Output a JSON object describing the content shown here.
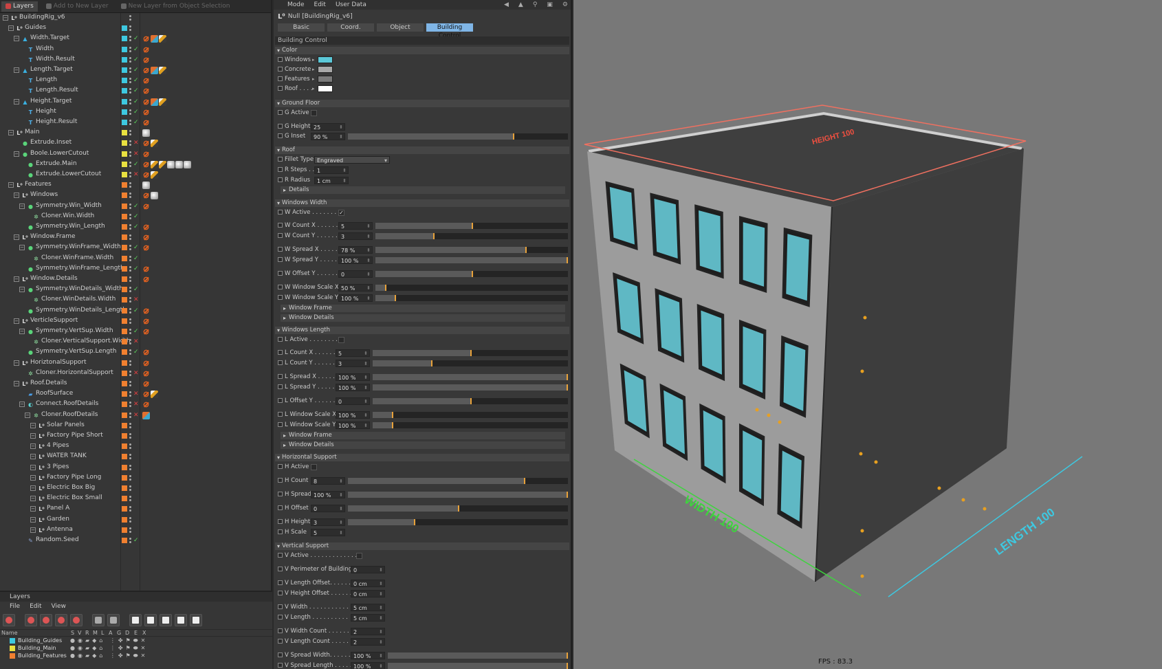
{
  "object_manager": {
    "tabs": [
      "Layers",
      "Add to New Layer",
      "New Layer from Object Selection"
    ],
    "tree": [
      {
        "label": "BuildingRig_v6",
        "indent": 0,
        "icon": "null",
        "layer": "",
        "tags": []
      },
      {
        "label": "Guides",
        "indent": 1,
        "icon": "null",
        "layer": "#3ec8e0",
        "tags": []
      },
      {
        "label": "Width.Target",
        "indent": 2,
        "icon": "triangle",
        "layer": "#3ec8e0",
        "tags": [
          "no",
          "mx",
          "fl"
        ]
      },
      {
        "label": "Width",
        "indent": 3,
        "icon": "text",
        "layer": "#3ec8e0",
        "tags": [
          "no"
        ]
      },
      {
        "label": "Width.Result",
        "indent": 3,
        "icon": "text",
        "layer": "#3ec8e0",
        "tags": [
          "no"
        ]
      },
      {
        "label": "Length.Target",
        "indent": 2,
        "icon": "triangle",
        "layer": "#3ec8e0",
        "tags": [
          "no",
          "mx",
          "fl"
        ]
      },
      {
        "label": "Length",
        "indent": 3,
        "icon": "text",
        "layer": "#3ec8e0",
        "tags": [
          "no"
        ]
      },
      {
        "label": "Length.Result",
        "indent": 3,
        "icon": "text",
        "layer": "#3ec8e0",
        "tags": [
          "no"
        ]
      },
      {
        "label": "Height.Target",
        "indent": 2,
        "icon": "triangle",
        "layer": "#3ec8e0",
        "tags": [
          "no",
          "mx",
          "fl"
        ]
      },
      {
        "label": "Height",
        "indent": 3,
        "icon": "text",
        "layer": "#3ec8e0",
        "tags": [
          "no"
        ]
      },
      {
        "label": "Height.Result",
        "indent": 3,
        "icon": "text",
        "layer": "#3ec8e0",
        "tags": [
          "no"
        ]
      },
      {
        "label": "Main",
        "indent": 1,
        "icon": "null",
        "layer": "#e8e040",
        "tags": [
          "sp"
        ]
      },
      {
        "label": "Extrude.Inset",
        "indent": 2,
        "icon": "green",
        "layer": "#e8e040",
        "tags": [
          "no",
          "fl"
        ]
      },
      {
        "label": "Boole.LowerCutout",
        "indent": 2,
        "icon": "green",
        "layer": "#e8e040",
        "tags": [
          "no"
        ]
      },
      {
        "label": "Extrude.Main",
        "indent": 3,
        "icon": "green",
        "layer": "#e8e040",
        "tags": [
          "no",
          "fl",
          "fl",
          "sp",
          "sp",
          "sp"
        ]
      },
      {
        "label": "Extrude.LowerCutout",
        "indent": 3,
        "icon": "green",
        "layer": "#e8e040",
        "tags": [
          "no",
          "fl"
        ]
      },
      {
        "label": "Features",
        "indent": 1,
        "icon": "null",
        "layer": "#f08030",
        "tags": [
          "sp"
        ]
      },
      {
        "label": "Windows",
        "indent": 2,
        "icon": "null",
        "layer": "#f08030",
        "tags": [
          "no",
          "sp"
        ]
      },
      {
        "label": "Symmetry.Win_Width",
        "indent": 3,
        "icon": "green",
        "layer": "#f08030",
        "tags": [
          "no"
        ]
      },
      {
        "label": "Cloner.Win.Width",
        "indent": 4,
        "icon": "gear",
        "layer": "#f08030",
        "tags": []
      },
      {
        "label": "Symmetry.Win_Length",
        "indent": 3,
        "icon": "green",
        "layer": "#f08030",
        "tags": [
          "no"
        ]
      },
      {
        "label": "Window.Frame",
        "indent": 2,
        "icon": "null",
        "layer": "#f08030",
        "tags": [
          "no"
        ]
      },
      {
        "label": "Symmetry.WinFrame_Width",
        "indent": 3,
        "icon": "green",
        "layer": "#f08030",
        "tags": [
          "no"
        ]
      },
      {
        "label": "Cloner.WinFrame.Width",
        "indent": 4,
        "icon": "gear",
        "layer": "#f08030",
        "tags": []
      },
      {
        "label": "Symmetry.WinFrame_Length",
        "indent": 3,
        "icon": "green",
        "layer": "#f08030",
        "tags": [
          "no"
        ]
      },
      {
        "label": "Window.Details",
        "indent": 2,
        "icon": "null",
        "layer": "#f08030",
        "tags": [
          "no"
        ]
      },
      {
        "label": "Symmetry.WinDetails_Width",
        "indent": 3,
        "icon": "green",
        "layer": "#f08030",
        "tags": []
      },
      {
        "label": "Cloner.WinDetails.Width",
        "indent": 4,
        "icon": "gear",
        "layer": "#f08030",
        "tags": []
      },
      {
        "label": "Symmetry.WinDetails_Length",
        "indent": 3,
        "icon": "green",
        "layer": "#f08030",
        "tags": [
          "no"
        ]
      },
      {
        "label": "VerticleSupport",
        "indent": 2,
        "icon": "null",
        "layer": "#f08030",
        "tags": [
          "no"
        ]
      },
      {
        "label": "Symmetry.VertSup.Width",
        "indent": 3,
        "icon": "green",
        "layer": "#f08030",
        "tags": [
          "no"
        ]
      },
      {
        "label": "Cloner.VerticalSupport.Width",
        "indent": 4,
        "icon": "gear",
        "layer": "#f08030",
        "tags": []
      },
      {
        "label": "Symmetry.VertSup.Length",
        "indent": 3,
        "icon": "green",
        "layer": "#f08030",
        "tags": [
          "no"
        ]
      },
      {
        "label": "HoriztonalSupport",
        "indent": 2,
        "icon": "null",
        "layer": "#f08030",
        "tags": [
          "no"
        ]
      },
      {
        "label": "Cloner.HorizontalSupport",
        "indent": 3,
        "icon": "gear",
        "layer": "#f08030",
        "tags": [
          "no"
        ]
      },
      {
        "label": "Roof.Details",
        "indent": 2,
        "icon": "null",
        "layer": "#f08030",
        "tags": [
          "no"
        ]
      },
      {
        "label": "RoofSurface",
        "indent": 3,
        "icon": "plane",
        "layer": "#f08030",
        "tags": [
          "no",
          "fl"
        ]
      },
      {
        "label": "Connect.RoofDetails",
        "indent": 3,
        "icon": "cyan",
        "layer": "#f08030",
        "tags": [
          "no"
        ]
      },
      {
        "label": "Cloner.RoofDetails",
        "indent": 4,
        "icon": "gear",
        "layer": "#f08030",
        "tags": [
          "mx"
        ]
      },
      {
        "label": "Solar Panels",
        "indent": 5,
        "icon": "null",
        "layer": "#f08030",
        "tags": []
      },
      {
        "label": "Factory Pipe Short",
        "indent": 5,
        "icon": "null",
        "layer": "#f08030",
        "tags": []
      },
      {
        "label": "4 Pipes",
        "indent": 5,
        "icon": "null",
        "layer": "#f08030",
        "tags": []
      },
      {
        "label": "WATER TANK",
        "indent": 5,
        "icon": "null",
        "layer": "#f08030",
        "tags": []
      },
      {
        "label": "3 Pipes",
        "indent": 5,
        "icon": "null",
        "layer": "#f08030",
        "tags": []
      },
      {
        "label": "Factory Pipe Long",
        "indent": 5,
        "icon": "null",
        "layer": "#f08030",
        "tags": []
      },
      {
        "label": "Electric Box Big",
        "indent": 5,
        "icon": "null",
        "layer": "#f08030",
        "tags": []
      },
      {
        "label": "Electric Box Small",
        "indent": 5,
        "icon": "null",
        "layer": "#f08030",
        "tags": []
      },
      {
        "label": "Panel A",
        "indent": 5,
        "icon": "null",
        "layer": "#f08030",
        "tags": []
      },
      {
        "label": "Garden",
        "indent": 5,
        "icon": "null",
        "layer": "#f08030",
        "tags": []
      },
      {
        "label": "Antenna",
        "indent": 5,
        "icon": "null",
        "layer": "#f08030",
        "tags": []
      },
      {
        "label": "Random.Seed",
        "indent": 3,
        "icon": "seed",
        "layer": "#f08030",
        "tags": []
      }
    ],
    "checks": [
      "",
      "",
      "check",
      "check",
      "check",
      "check",
      "check",
      "check",
      "check",
      "check",
      "check",
      "",
      "cross",
      "cross",
      "check",
      "cross",
      "",
      "",
      "check",
      "check",
      "check",
      "",
      "check",
      "check",
      "check",
      "",
      "check",
      "cross",
      "check",
      "",
      "check",
      "cross",
      "check",
      "",
      "cross",
      "",
      "cross",
      "cross",
      "cross",
      "",
      "",
      "",
      "",
      "",
      "",
      "",
      "",
      "",
      "",
      "",
      "check"
    ]
  },
  "layers": {
    "title": "Layers",
    "menu": [
      "File",
      "Edit",
      "View"
    ],
    "columns": [
      "Name",
      "S",
      "V",
      "R",
      "M",
      "L",
      "A",
      "G",
      "D",
      "E",
      "X"
    ],
    "rows": [
      {
        "name": "Building_Guides",
        "color": "#3ec8e0"
      },
      {
        "name": "Building_Main",
        "color": "#e8e040"
      },
      {
        "name": "Building_Features",
        "color": "#f08030"
      }
    ]
  },
  "attributes": {
    "menu": [
      "Mode",
      "Edit",
      "User Data"
    ],
    "object_title": "Null [BuildingRig_v6]",
    "tabs": [
      "Basic",
      "Coord.",
      "Object",
      "Building Control"
    ],
    "active_tab": "Building Control",
    "section_title": "Building Control",
    "groups": {
      "color": {
        "title": "Color",
        "items": [
          {
            "label": "Windows",
            "color": "#5bc8d8"
          },
          {
            "label": "Concrete",
            "color": "#a8a8a8"
          },
          {
            "label": "Features",
            "color": "#7a7a7a"
          },
          {
            "label": "Roof . . . .",
            "color": "#ffffff"
          }
        ]
      },
      "ground_floor": {
        "title": "Ground Floor",
        "g_active_label": "G Active",
        "g_height_label": "G Height",
        "g_height_value": "25",
        "g_inset_label": "G Inset",
        "g_inset_value": "90 %",
        "g_inset_fraction": 0.75
      },
      "roof": {
        "title": "Roof",
        "fillet_type_label": "Fillet Type",
        "fillet_type_value": "Engraved",
        "r_steps_label": "R Steps . .",
        "r_steps_value": "1",
        "r_radius_label": "R Radius",
        "r_radius_value": "1 cm",
        "details_label": "Details"
      },
      "windows_width": {
        "title": "Windows Width",
        "w_active_label": "W Active . . . . . . . . .",
        "w_active_checked": true,
        "rows": [
          {
            "label": "W Count X . . . . . . .",
            "value": "5",
            "fraction": 0.5
          },
          {
            "label": "W Count Y . . . . . . .",
            "value": "3",
            "fraction": 0.3
          },
          {
            "label": "W Spread X . . . . . .",
            "value": "78 %",
            "fraction": 0.78
          },
          {
            "label": "W Spread Y . . . . . .",
            "value": "100 %",
            "fraction": 1.0
          },
          {
            "label": "W Offset Y . . . . . .",
            "value": "0",
            "fraction": 0.5
          },
          {
            "label": "W Window Scale X",
            "value": "50 %",
            "fraction": 0.05
          },
          {
            "label": "W Window Scale Y",
            "value": "100 %",
            "fraction": 0.1
          }
        ],
        "window_frame_label": "Window Frame",
        "window_details_label": "Window Details"
      },
      "windows_length": {
        "title": "Windows Length",
        "l_active_label": "L Active . . . . . . . . .",
        "rows": [
          {
            "label": "L Count X . . . . . . .",
            "value": "5",
            "fraction": 0.5
          },
          {
            "label": "L Count Y . . . . . . .",
            "value": "3",
            "fraction": 0.3
          },
          {
            "label": "L Spread X . . . . . .",
            "value": "100 %",
            "fraction": 1.0
          },
          {
            "label": "L Spread Y . . . . . .",
            "value": "100 %",
            "fraction": 1.0
          },
          {
            "label": "L Offset Y . . . . . .",
            "value": "0",
            "fraction": 0.5
          },
          {
            "label": "L Window Scale X",
            "value": "100 %",
            "fraction": 0.1
          },
          {
            "label": "L Window Scale Y",
            "value": "100 %",
            "fraction": 0.1
          }
        ],
        "window_frame_label": "Window Frame",
        "window_details_label": "Window Details"
      },
      "horizontal_support": {
        "title": "Horizontal Support",
        "h_active_label": "H Active",
        "rows": [
          {
            "label": "H Count",
            "value": "8",
            "fraction": 0.8
          },
          {
            "label": "H Spread",
            "value": "100 %",
            "fraction": 1.0
          },
          {
            "label": "H Offset",
            "value": "0",
            "fraction": 0.5
          },
          {
            "label": "H Height",
            "value": "3",
            "fraction": 0.3
          },
          {
            "label": "H Scale",
            "value": "5",
            "fraction": null
          }
        ]
      },
      "vertical_support": {
        "title": "Vertical Support",
        "v_active_label": "V Active . . . . . . . . . . . . . .",
        "rows": [
          {
            "label": "V Perimeter of Building",
            "value": "0"
          },
          {
            "label": "V Length Offset. . . . . .",
            "value": "0 cm"
          },
          {
            "label": "V Height Offset . . . . . .",
            "value": "0 cm"
          },
          {
            "label": "V Width . . . . . . . . . . .",
            "value": "5 cm"
          },
          {
            "label": "V Length . . . . . . . . . .",
            "value": "5 cm"
          },
          {
            "label": "V Width Count . . . . . .",
            "value": "2"
          },
          {
            "label": "V  Length Count . . . . .",
            "value": "2"
          },
          {
            "label": "V Spread Width. . . . . .",
            "value": "100 %",
            "fraction": 1.0
          },
          {
            "label": "V Spread Length . . . . .",
            "value": "100 %",
            "fraction": 1.0
          }
        ]
      }
    }
  },
  "viewport": {
    "width_label": "WIDTH  100",
    "length_label": "LENGTH  100",
    "height_label": "HEIGHT 100",
    "fps": "FPS : 83.3",
    "colors": {
      "window": "#5fb8c4",
      "width_guide": "#3ed43e",
      "length_guide": "#3ec8e0",
      "height_guide": "#f06050"
    }
  }
}
